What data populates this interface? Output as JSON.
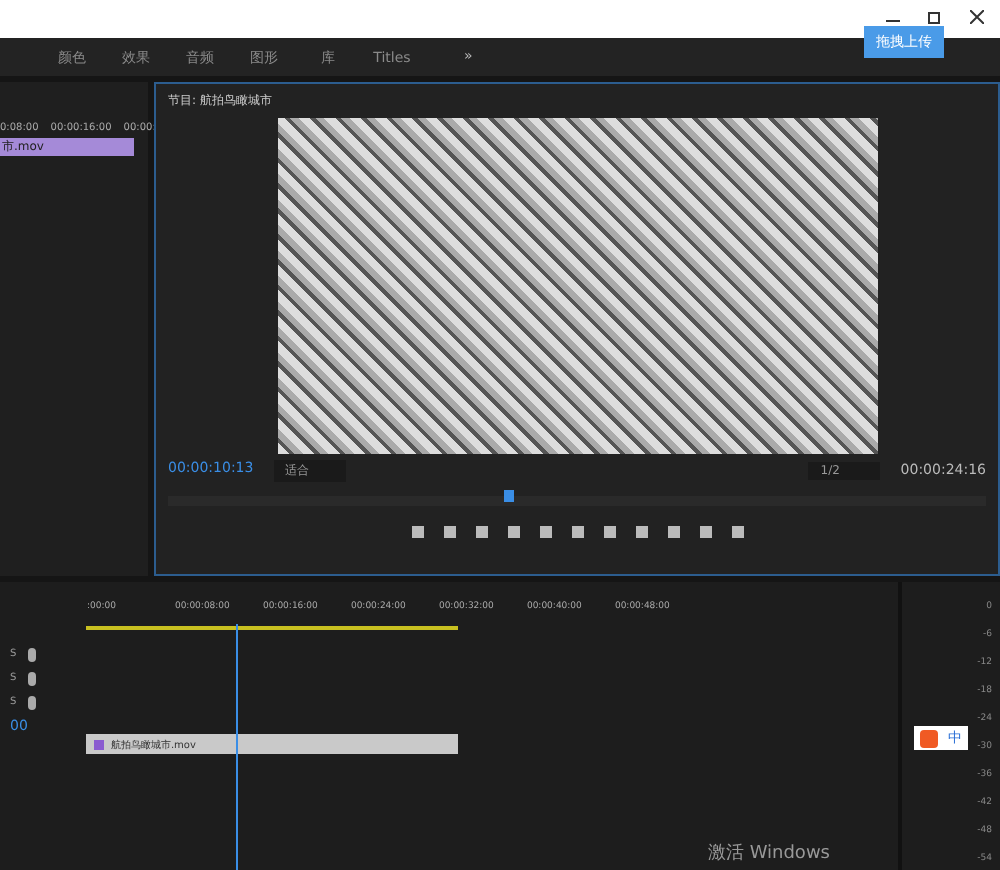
{
  "upload_button": "拖拽上传",
  "tabs": [
    {
      "label": "颜色",
      "selected": false
    },
    {
      "label": "效果",
      "selected": false
    },
    {
      "label": "音频",
      "selected": false
    },
    {
      "label": "图形",
      "selected": false
    },
    {
      "label": "库",
      "selected": false
    },
    {
      "label": "Titles",
      "selected": false
    }
  ],
  "tabs_more": "»",
  "source_panel": {
    "ruler": [
      "0:08:00",
      "00:00:16:00",
      "00:00:"
    ],
    "clip": "市.mov"
  },
  "program_monitor": {
    "title": "节目: 航拍鸟瞰城市",
    "timecode": "00:00:10:13",
    "fit": "适合",
    "resolution": "1/2",
    "duration": "00:00:24:16",
    "level": 0.41
  },
  "timeline": {
    "ruler": [
      ":00:00",
      "00:00:08:00",
      "00:00:16:00",
      "00:00:24:00",
      "00:00:32:00",
      "00:00:40:00",
      "00:00:48:00"
    ],
    "clip": "航拍鸟瞰城市.mov",
    "tracks": [
      "S",
      "S",
      "S"
    ],
    "timecode": "00"
  },
  "meter_scale": [
    "0",
    "-6",
    "-12",
    "-18",
    "-24",
    "-30",
    "-36",
    "-42",
    "-48",
    "-54"
  ],
  "ime_toolbar": {
    "mode": "中"
  },
  "os_notice": "激活 Windows"
}
